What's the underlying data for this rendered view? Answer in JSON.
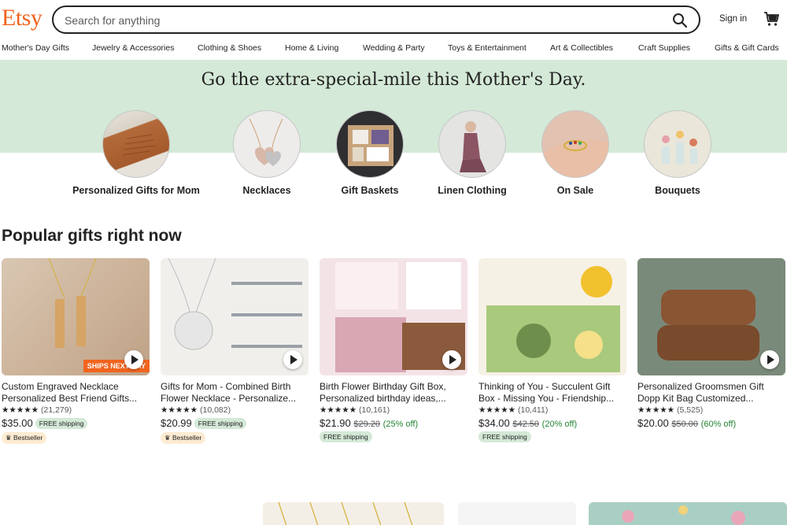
{
  "header": {
    "logo": "Etsy",
    "search_placeholder": "Search for anything",
    "signin": "Sign in"
  },
  "nav": [
    "Mother's Day Gifts",
    "Jewelry & Accessories",
    "Clothing & Shoes",
    "Home & Living",
    "Wedding & Party",
    "Toys & Entertainment",
    "Art & Collectibles",
    "Craft Supplies",
    "Gifts & Gift Cards"
  ],
  "hero": {
    "title": "Go the extra-special-mile this Mother's Day.",
    "categories": [
      "Personalized Gifts for Mom",
      "Necklaces",
      "Gift Baskets",
      "Linen Clothing",
      "On Sale",
      "Bouquets"
    ]
  },
  "popular": {
    "title": "Popular gifts right now",
    "items": [
      {
        "title": "Custom Engraved Necklace Personalized Best Friend Gifts...",
        "stars": "★★★★★",
        "count": "(21,279)",
        "price": "$35.00",
        "orig": "",
        "pct": "",
        "free": "FREE shipping",
        "badge": "Bestseller",
        "ships": "SHIPS NEXT DAY"
      },
      {
        "title": "Gifts for Mom - Combined Birth Flower Necklace - Personalize...",
        "stars": "★★★★★",
        "count": "(10,082)",
        "price": "$20.99",
        "orig": "",
        "pct": "",
        "free": "FREE shipping",
        "badge": "Bestseller",
        "ships": ""
      },
      {
        "title": "Birth Flower Birthday Gift Box, Personalized birthday ideas,...",
        "stars": "★★★★★",
        "count": "(10,161)",
        "price": "$21.90",
        "orig": "$29.20",
        "pct": "(25% off)",
        "free": "FREE shipping",
        "badge": "",
        "ships": ""
      },
      {
        "title": "Thinking of You - Succulent Gift Box - Missing You - Friendship...",
        "stars": "★★★★★",
        "count": "(10,411)",
        "price": "$34.00",
        "orig": "$42.50",
        "pct": "(20% off)",
        "free": "FREE shipping",
        "badge": "",
        "ships": ""
      },
      {
        "title": "Personalized Groomsmen Gift Dopp Kit Bag Customized...",
        "stars": "★★★★★",
        "count": "(5,525)",
        "price": "$20.00",
        "orig": "$50.00",
        "pct": "(60% off)",
        "free": "",
        "badge": "",
        "ships": ""
      }
    ]
  },
  "colors": {
    "brand": "#f1641e",
    "hero_band": "#d4e9d7",
    "free_ship_bg": "#d4e9d7",
    "bestseller_bg": "#fdebd2",
    "discount": "#258635"
  }
}
